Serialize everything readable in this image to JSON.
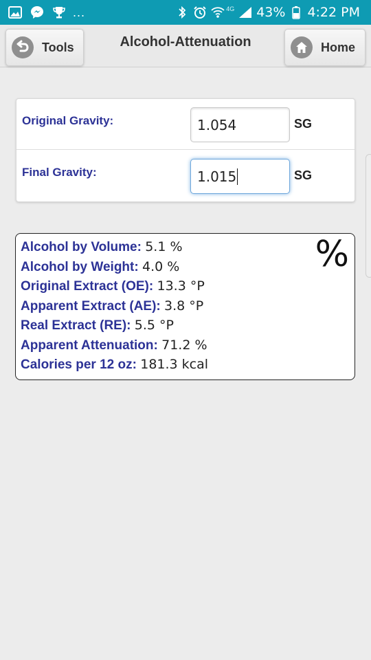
{
  "status_bar": {
    "dots": "...",
    "network": "4G",
    "battery": "43%",
    "time": "4:22 PM",
    "icons_left": [
      "gallery-icon",
      "messenger-icon",
      "trophy-icon"
    ],
    "icons_right": [
      "bluetooth-icon",
      "alarm-icon",
      "wifi-icon",
      "signal-icon",
      "battery-icon"
    ]
  },
  "header": {
    "title": "Alcohol-Attenuation",
    "tools_label": "Tools",
    "home_label": "Home"
  },
  "inputs": {
    "og_label": "Original Gravity:",
    "og_value": "1.054",
    "og_unit": "SG",
    "fg_label": "Final Gravity:",
    "fg_value": "1.015",
    "fg_unit": "SG"
  },
  "results": {
    "symbol": "%",
    "rows": [
      {
        "label": "Alcohol by Volume:",
        "value": "5.1 %"
      },
      {
        "label": "Alcohol by Weight:",
        "value": "4.0 %"
      },
      {
        "label": "Original Extract (OE):",
        "value": "13.3 °P"
      },
      {
        "label": "Apparent Extract (AE):",
        "value": "3.8 °P"
      },
      {
        "label": "Real Extract (RE):",
        "value": "5.5 °P"
      },
      {
        "label": "Apparent Attenuation:",
        "value": "71.2 %"
      },
      {
        "label": "Calories per 12 oz:",
        "value": "181.3 kcal"
      }
    ]
  },
  "colors": {
    "status_bar": "#0e9bb3",
    "label_blue": "#2c3296",
    "background": "#ececec"
  }
}
